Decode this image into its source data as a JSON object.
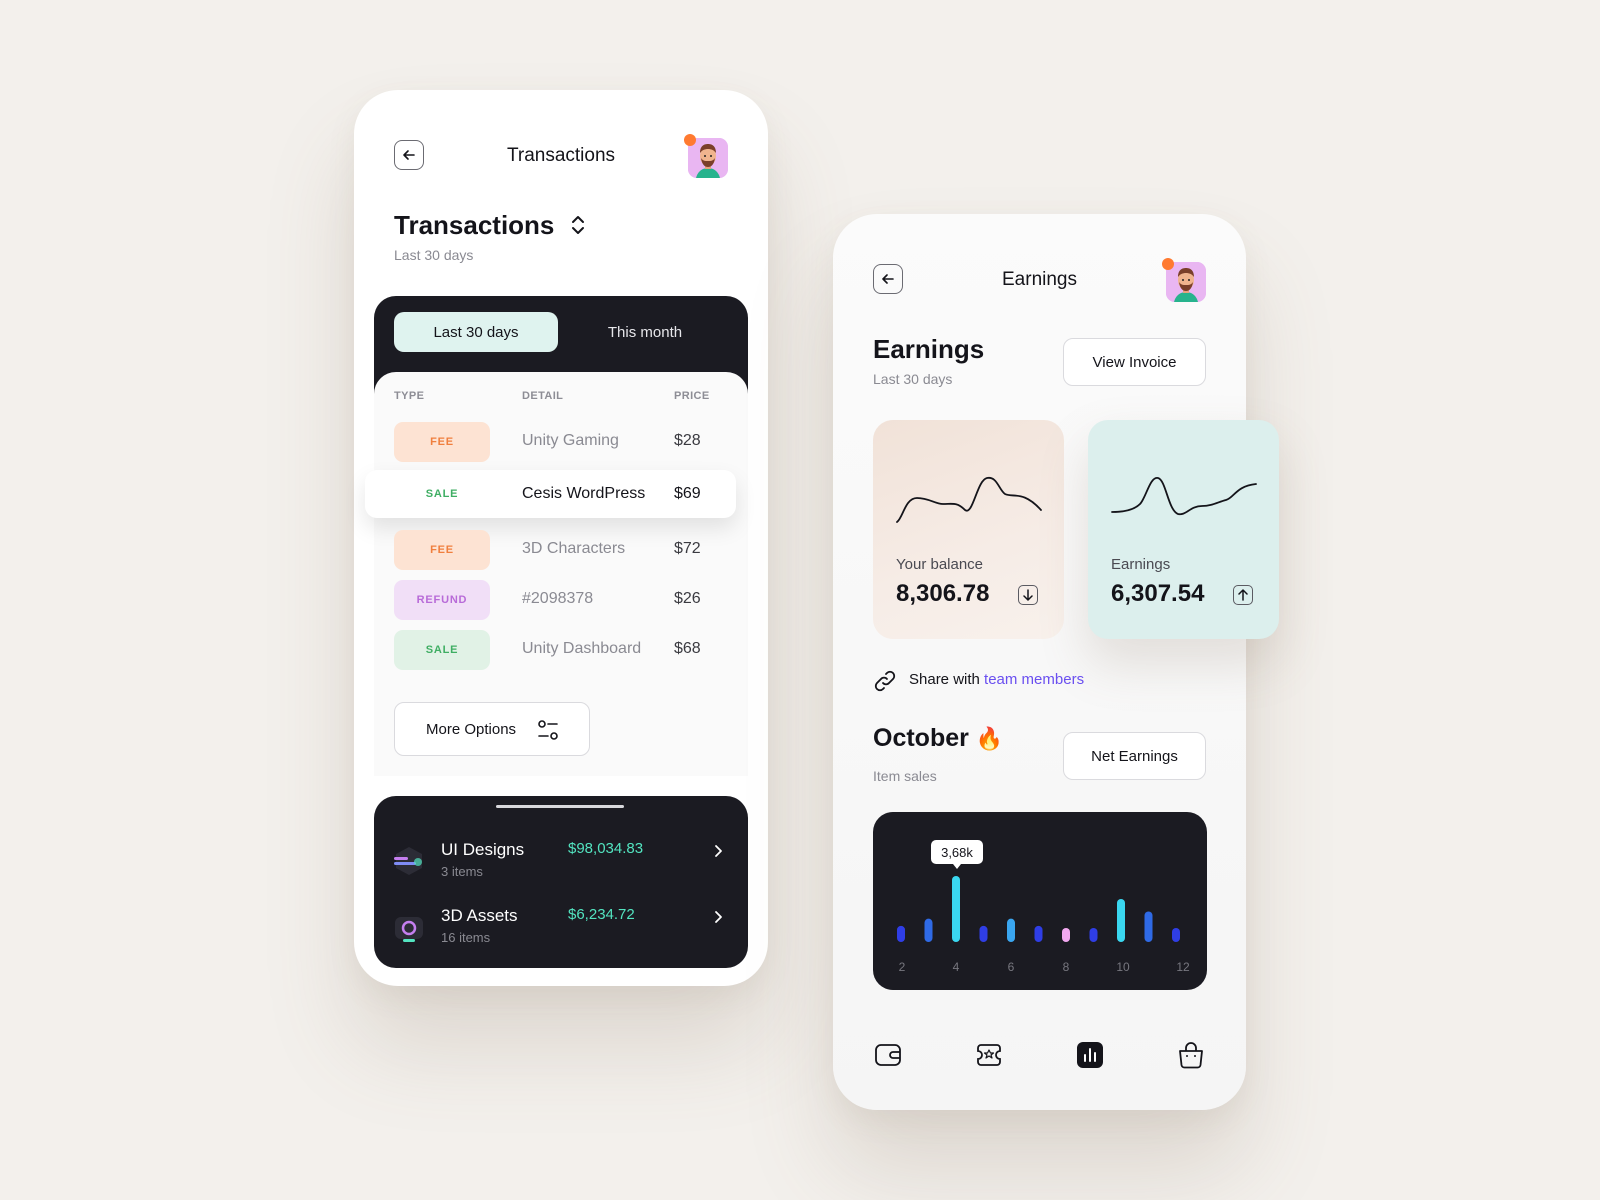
{
  "transactions_screen": {
    "topbar_title": "Transactions",
    "heading": "Transactions",
    "subtitle": "Last 30 days",
    "tabs": [
      {
        "label": "Last 30 days",
        "active": true
      },
      {
        "label": "This month",
        "active": false
      }
    ],
    "columns": [
      "TYPE",
      "DETAIL",
      "PRICE"
    ],
    "rows": [
      {
        "type": "FEE",
        "detail": "Unity Gaming",
        "price": "$28",
        "highlighted": false
      },
      {
        "type": "SALE",
        "detail": "Cesis WordPress",
        "price": "$69",
        "highlighted": true
      },
      {
        "type": "FEE",
        "detail": "3D Characters",
        "price": "$72",
        "highlighted": false
      },
      {
        "type": "REFUND",
        "detail": "#2098378",
        "price": "$26",
        "highlighted": false
      },
      {
        "type": "SALE",
        "detail": "Unity Dashboard",
        "price": "$68",
        "highlighted": false
      }
    ],
    "more_options_label": "More Options",
    "assets": [
      {
        "name": "UI Designs",
        "count": "3 items",
        "amount": "$98,034.83",
        "icon": "ui-designs-icon"
      },
      {
        "name": "3D Assets",
        "count": "16 items",
        "amount": "$6,234.72",
        "icon": "camera-icon"
      }
    ]
  },
  "earnings_screen": {
    "topbar_title": "Earnings",
    "heading": "Earnings",
    "subtitle": "Last 30 days",
    "view_invoice_label": "View Invoice",
    "balance_card": {
      "label": "Your balance",
      "value": "8,306.78",
      "arrow": "down"
    },
    "earnings_card": {
      "label": "Earnings",
      "value": "6,307.54",
      "arrow": "up"
    },
    "share_prefix": "Share with",
    "share_link": "team members",
    "month_heading": "October",
    "month_emoji": "🔥",
    "month_sub": "Item sales",
    "net_earnings_label": "Net Earnings",
    "tooltip": "3,68k",
    "nav": [
      "wallet-icon",
      "ticket-star-icon",
      "chart-icon",
      "bag-icon"
    ],
    "active_nav": "chart-icon"
  },
  "colors": {
    "accent_teal": "#53e4c0",
    "link_purple": "#6a4ff0",
    "dark": "#1b1b22",
    "notification": "#ff7a30"
  },
  "chart_data": {
    "type": "bar",
    "x": [
      1,
      2,
      3,
      4,
      5,
      6,
      7,
      8,
      9,
      10,
      11,
      12
    ],
    "x_tick_labels": [
      "2",
      "4",
      "6",
      "8",
      "10",
      "12"
    ],
    "values": [
      0.9,
      1.3,
      3.68,
      0.9,
      1.3,
      0.9,
      0.6,
      0.6,
      2.4,
      1.7,
      0.6,
      0
    ],
    "highlight_index": 2,
    "highlight_label": "3,68k",
    "colors": [
      "#2f3ee6",
      "#2f6ae6",
      "#3ad7f0",
      "#2f3ee6",
      "#3aa6f0",
      "#2f3ee6",
      "#f2a8f0",
      "#2f3ee6",
      "#3ad7f0",
      "#2f6ae6",
      "#2f3ee6",
      "#2f3ee6"
    ],
    "title": "",
    "xlabel": "",
    "ylabel": "",
    "grid": false
  }
}
